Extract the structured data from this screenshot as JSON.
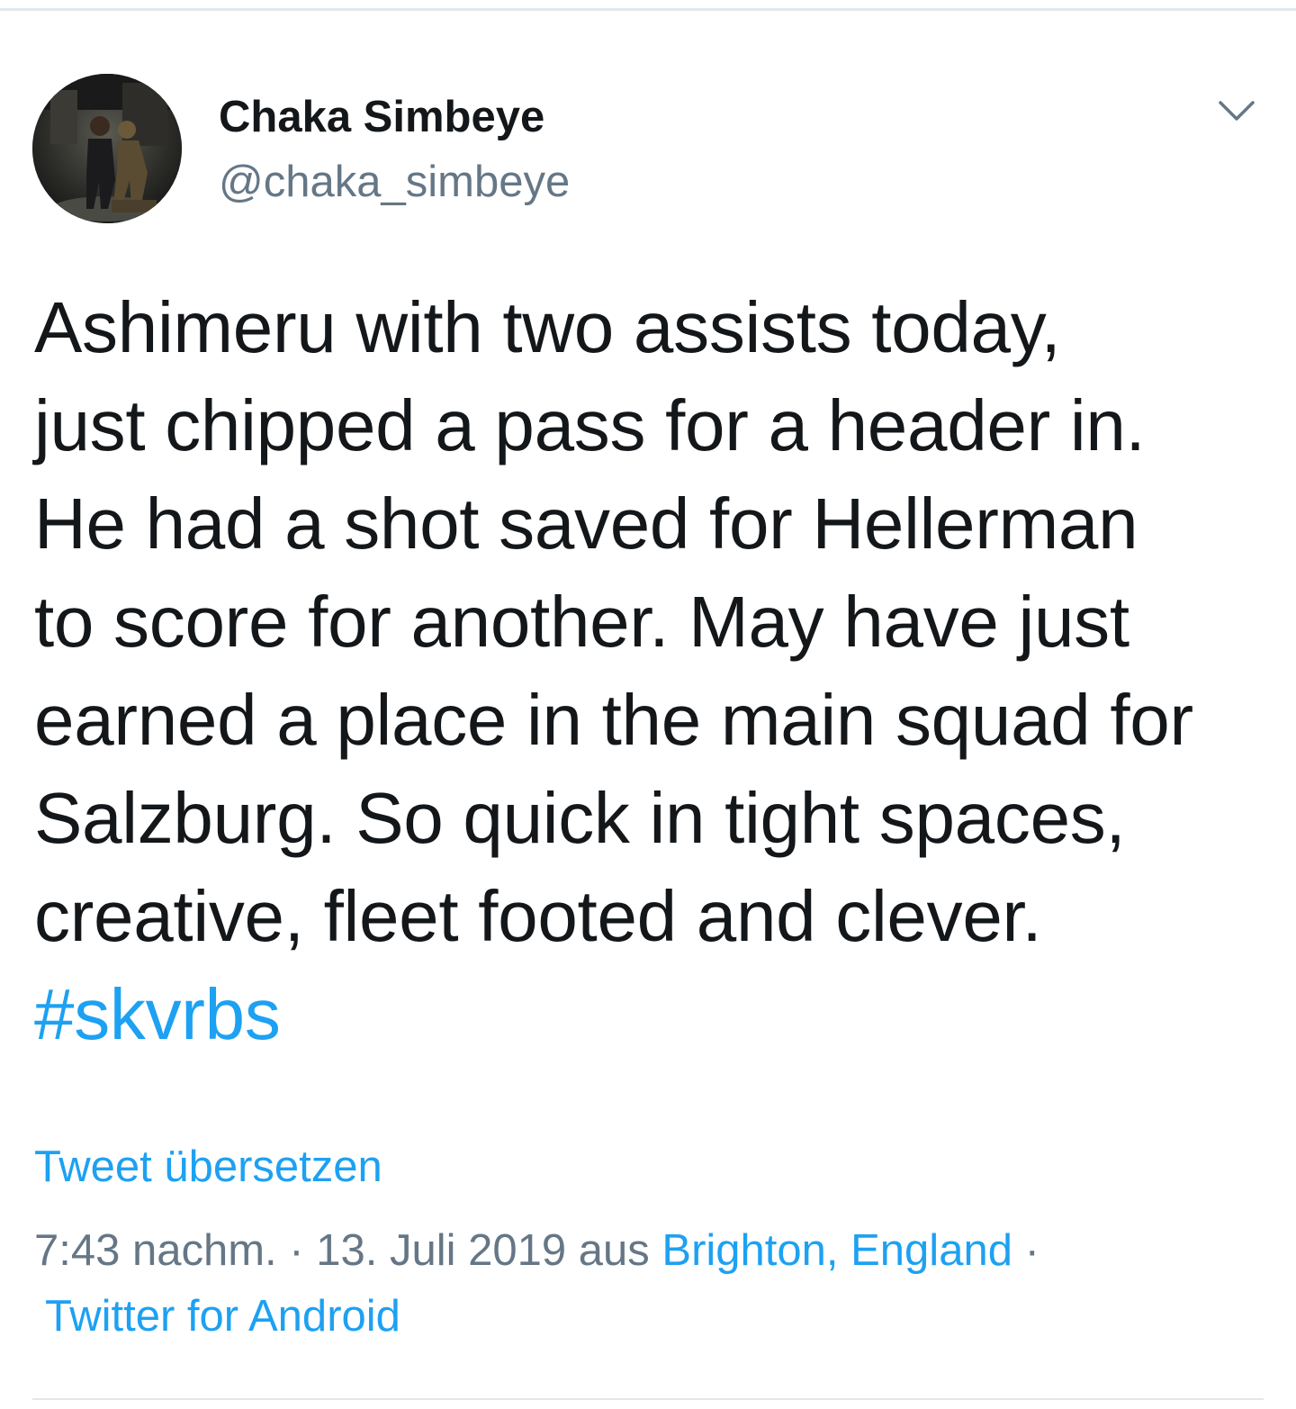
{
  "tweet": {
    "author": {
      "display_name": "Chaka Simbeye",
      "handle": "@chaka_simbeye"
    },
    "menu_icon": "chevron-down-icon",
    "text_lines": [
      "Ashimeru with two assists today,",
      "just chipped a pass for a header in.",
      "He had a shot saved for Hellerman",
      "to score for another. May have just",
      "earned a place in the main squad for",
      "Salzburg. So quick in tight spaces,",
      "creative, fleet footed and clever."
    ],
    "hashtag": "#skvrbs",
    "translate_label": "Tweet übersetzen",
    "meta": {
      "time": "7:43 nachm.",
      "separator": "·",
      "date": "13. Juli 2019",
      "from_label": "aus",
      "location": "Brighton, England",
      "source": "Twitter for Android"
    }
  },
  "colors": {
    "link": "#1da1f2",
    "text_primary": "#14171a",
    "text_secondary": "#657786",
    "divider": "#e1e8ed"
  }
}
